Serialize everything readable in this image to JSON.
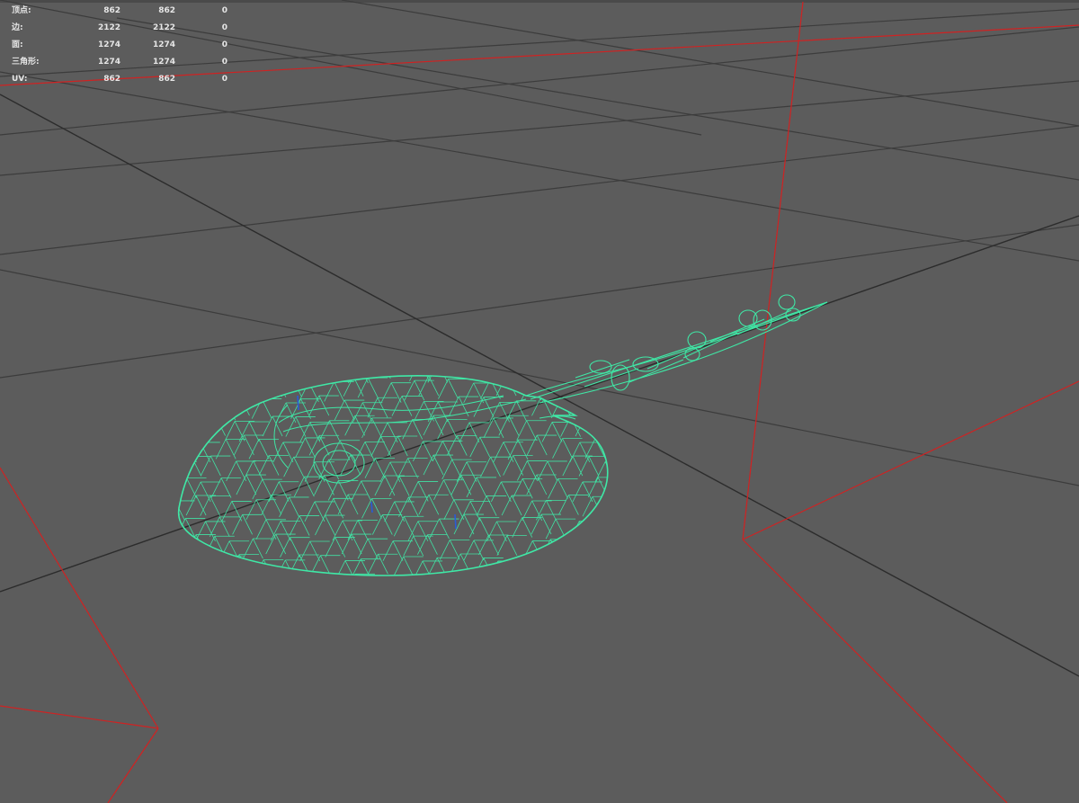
{
  "hud": {
    "rows": [
      {
        "label": "顶点:",
        "values": [
          "862",
          "862",
          "0"
        ]
      },
      {
        "label": "边:",
        "values": [
          "2122",
          "2122",
          "0"
        ]
      },
      {
        "label": "面:",
        "values": [
          "1274",
          "1274",
          "0"
        ]
      },
      {
        "label": "三角形:",
        "values": [
          "1274",
          "1274",
          "0"
        ]
      },
      {
        "label": "UV:",
        "values": [
          "862",
          "862",
          "0"
        ]
      }
    ]
  },
  "viewport": {
    "background_color": "#5c5c5c",
    "grid_color": "#3c3c3c",
    "axis_color": "#2a2a2a",
    "bounds_color": "#d02222",
    "wireframe_color": "#3fe8a6",
    "selection_color": "#2a5bd6",
    "hud_text_color": "#e6e6e6"
  }
}
